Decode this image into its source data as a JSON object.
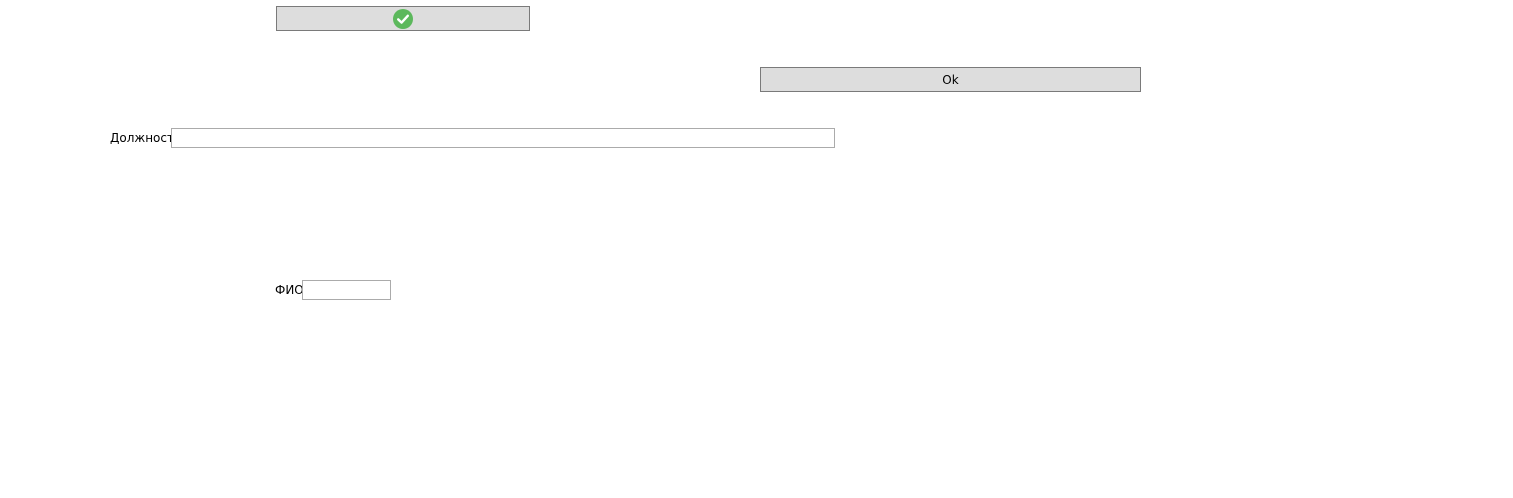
{
  "confirm_button": {
    "label": "",
    "icon": "check-circle-icon",
    "icon_color": "#5cb85c"
  },
  "ok_button": {
    "label": "Ok"
  },
  "position_field": {
    "label": "Должность",
    "value": "",
    "placeholder": ""
  },
  "fio_field": {
    "label": "ФИО",
    "value": "",
    "placeholder": ""
  }
}
